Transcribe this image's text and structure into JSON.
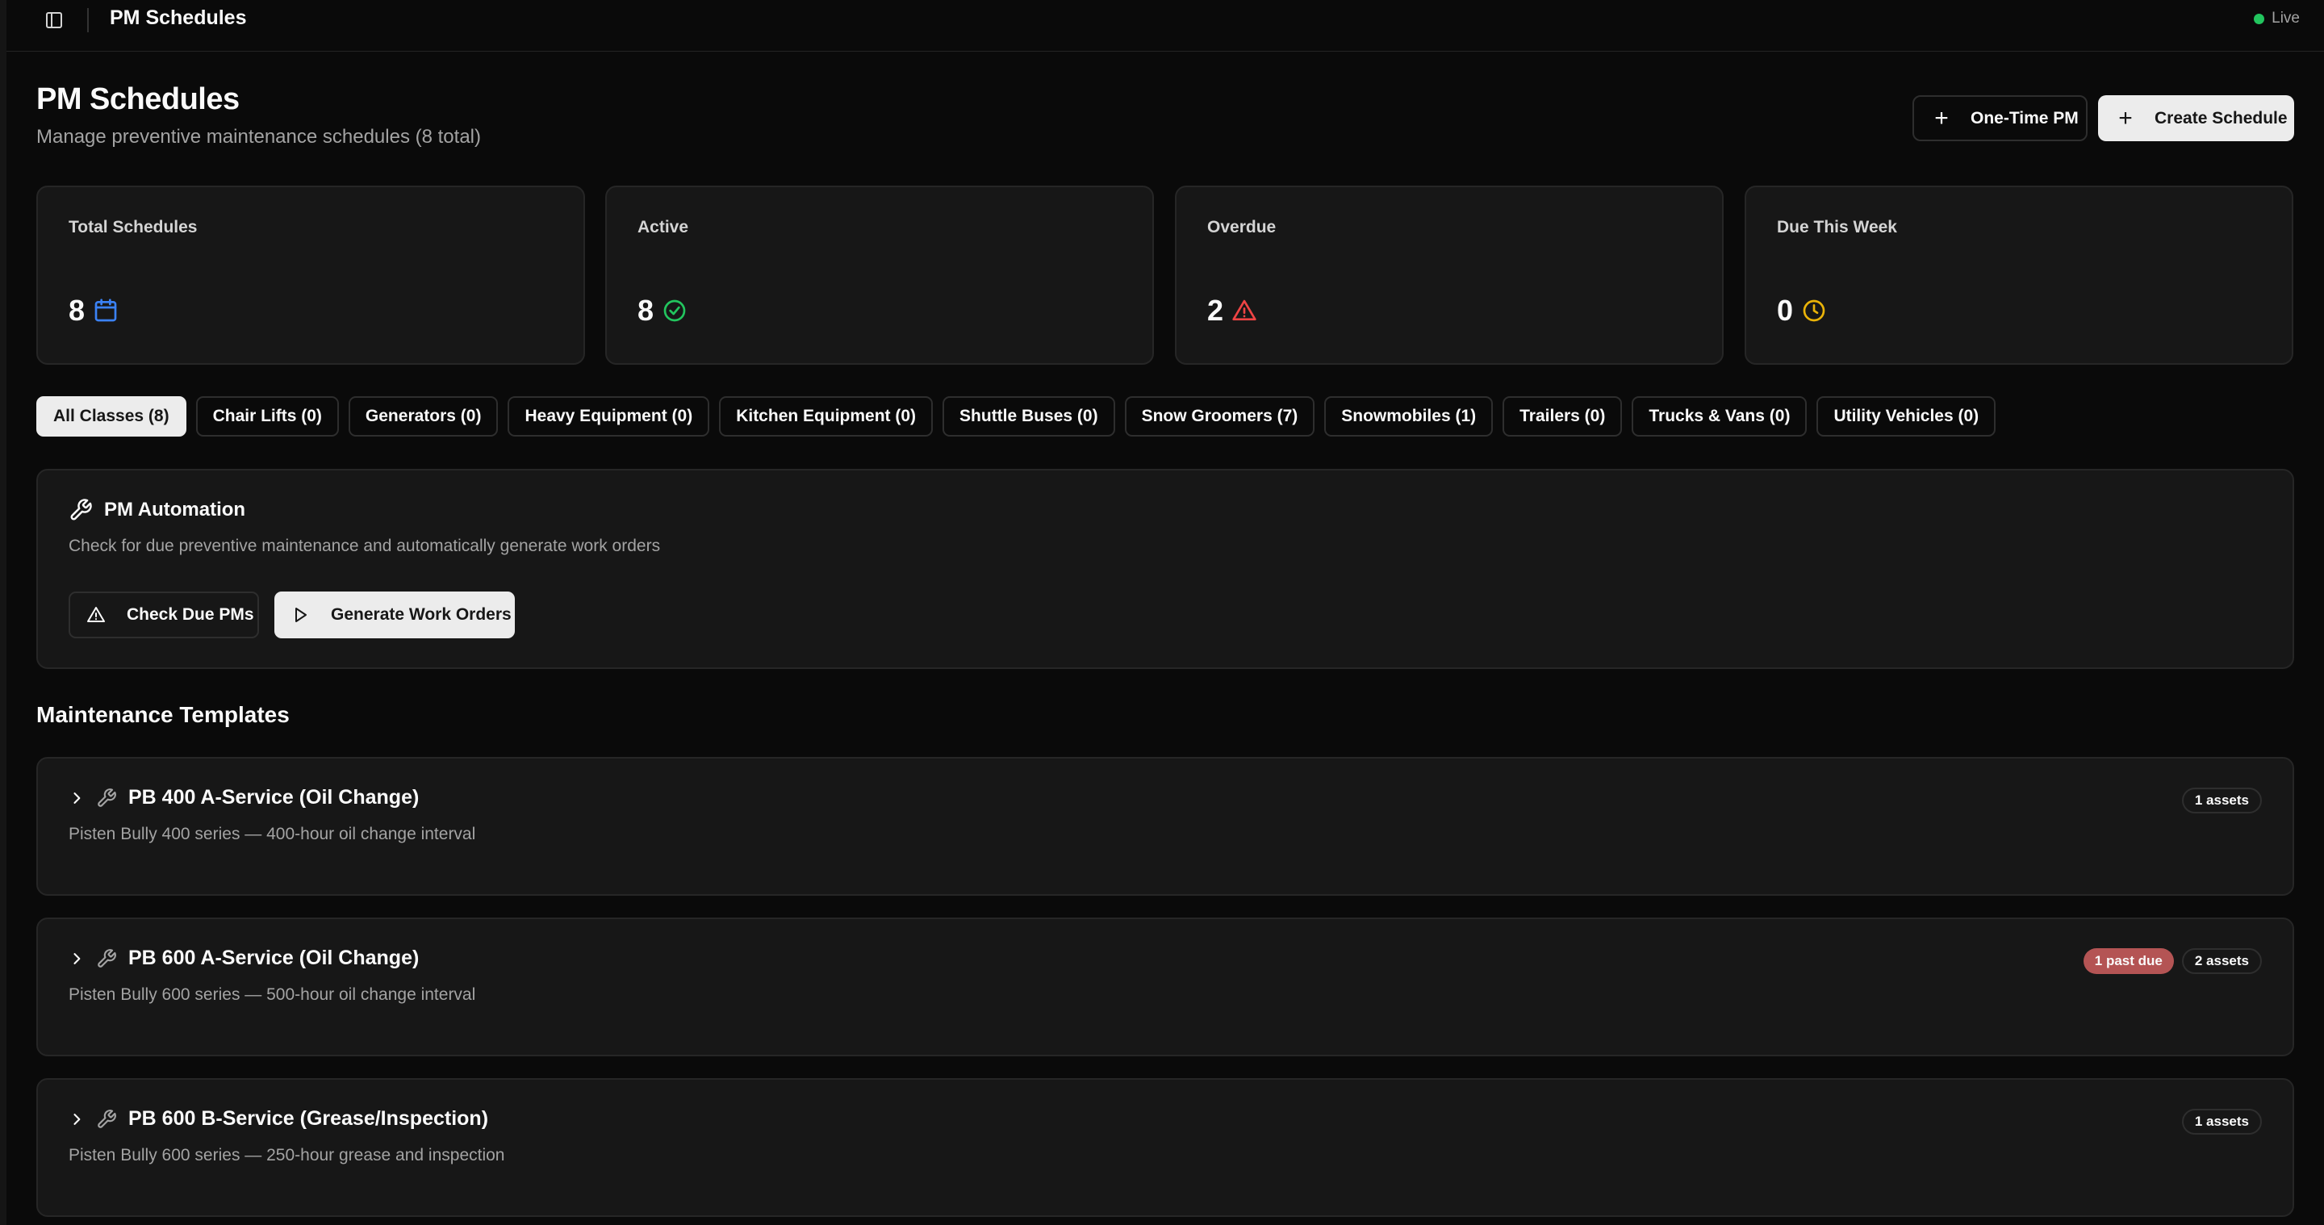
{
  "topbar": {
    "title": "PM Schedules",
    "live_label": "Live"
  },
  "page": {
    "title": "PM Schedules",
    "subtitle": "Manage preventive maintenance schedules (8 total)",
    "actions": {
      "one_time": "One-Time PM",
      "create": "Create Schedule"
    }
  },
  "stats": [
    {
      "label": "Total Schedules",
      "value": "8",
      "icon": "calendar-icon",
      "color": "#3b82f6"
    },
    {
      "label": "Active",
      "value": "8",
      "icon": "check-circle-icon",
      "color": "#22c55e"
    },
    {
      "label": "Overdue",
      "value": "2",
      "icon": "alert-triangle-icon",
      "color": "#ef4444"
    },
    {
      "label": "Due This Week",
      "value": "0",
      "icon": "clock-icon",
      "color": "#eab308"
    }
  ],
  "tabs": [
    {
      "label": "All Classes (8)",
      "active": true
    },
    {
      "label": "Chair Lifts (0)"
    },
    {
      "label": "Generators (0)"
    },
    {
      "label": "Heavy Equipment (0)"
    },
    {
      "label": "Kitchen Equipment (0)"
    },
    {
      "label": "Shuttle Buses (0)"
    },
    {
      "label": "Snow Groomers (7)"
    },
    {
      "label": "Snowmobiles (1)"
    },
    {
      "label": "Trailers (0)"
    },
    {
      "label": "Trucks & Vans (0)"
    },
    {
      "label": "Utility Vehicles (0)"
    }
  ],
  "automation": {
    "title": "PM Automation",
    "description": "Check for due preventive maintenance and automatically generate work orders",
    "check_label": "Check Due PMs",
    "generate_label": "Generate Work Orders"
  },
  "templates_section": {
    "title": "Maintenance Templates"
  },
  "templates": [
    {
      "name": "PB 400 A-Service (Oil Change)",
      "description": "Pisten Bully 400 series — 400-hour oil change interval",
      "past_due": "",
      "assets": "1 assets"
    },
    {
      "name": "PB 600 A-Service (Oil Change)",
      "description": "Pisten Bully 600 series — 500-hour oil change interval",
      "past_due": "1 past due",
      "assets": "2 assets"
    },
    {
      "name": "PB 600 B-Service (Grease/Inspection)",
      "description": "Pisten Bully 600 series — 250-hour grease and inspection",
      "past_due": "",
      "assets": "1 assets"
    }
  ],
  "colors": {
    "background": "#0a0a0a",
    "card": "#171717",
    "border": "#262626",
    "danger_badge": "#b45454",
    "live": "#22c55e"
  }
}
